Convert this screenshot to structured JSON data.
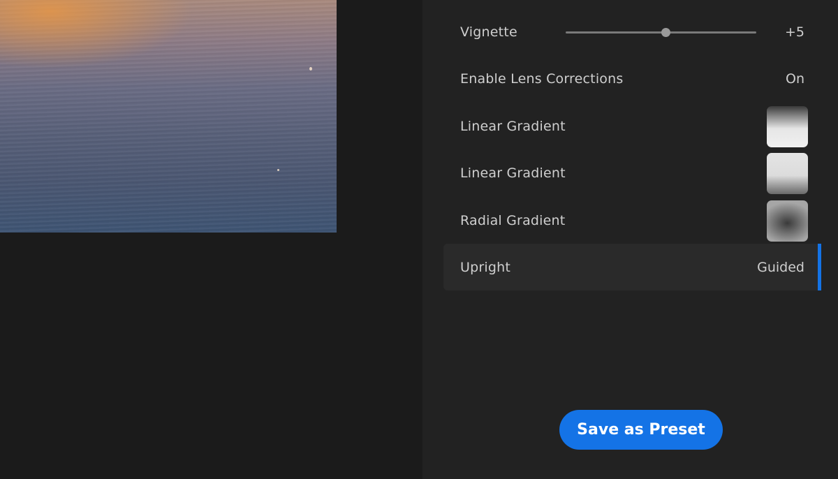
{
  "panel": {
    "rows": [
      {
        "label": "Vignette",
        "value": "+5",
        "slider_fraction": 0.525
      },
      {
        "label": "Enable Lens Corrections",
        "value": "On"
      },
      {
        "label": "Linear Gradient"
      },
      {
        "label": "Linear Gradient"
      },
      {
        "label": "Radial Gradient"
      },
      {
        "label": "Upright",
        "value": "Guided",
        "selected": true
      }
    ]
  },
  "actions": {
    "save_preset_label": "Save as Preset"
  },
  "colors": {
    "accent": "#1473e6",
    "panel_background": "#222222",
    "canvas_background": "#1b1b1b"
  }
}
